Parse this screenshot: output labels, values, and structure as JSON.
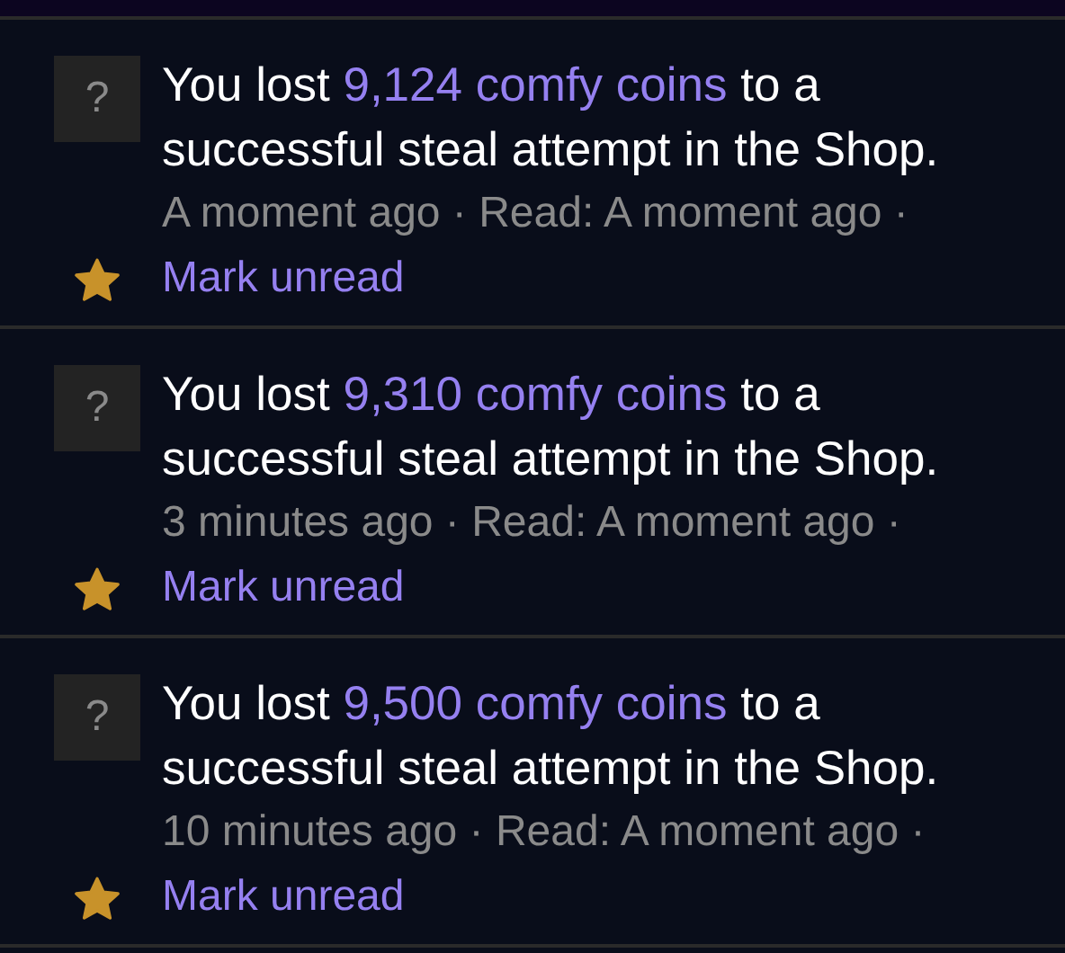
{
  "notifications": [
    {
      "icon": "?",
      "prefix": "You lost",
      "amount": "9,124 comfy coins",
      "suffix": "to a successful steal attempt in the Shop.",
      "meta": "A moment ago · Read: A moment ago ·",
      "action": "Mark unread",
      "starred": true
    },
    {
      "icon": "?",
      "prefix": "You lost",
      "amount": "9,310 comfy coins",
      "suffix": "to a successful steal attempt in the Shop.",
      "meta": "3 minutes ago · Read: A moment ago ·",
      "action": "Mark unread",
      "starred": true
    },
    {
      "icon": "?",
      "prefix": "You lost",
      "amount": "9,500 comfy coins",
      "suffix": "to a successful steal attempt in the Shop.",
      "meta": "10 minutes ago · Read: A moment ago ·",
      "action": "Mark unread",
      "starred": true
    }
  ]
}
